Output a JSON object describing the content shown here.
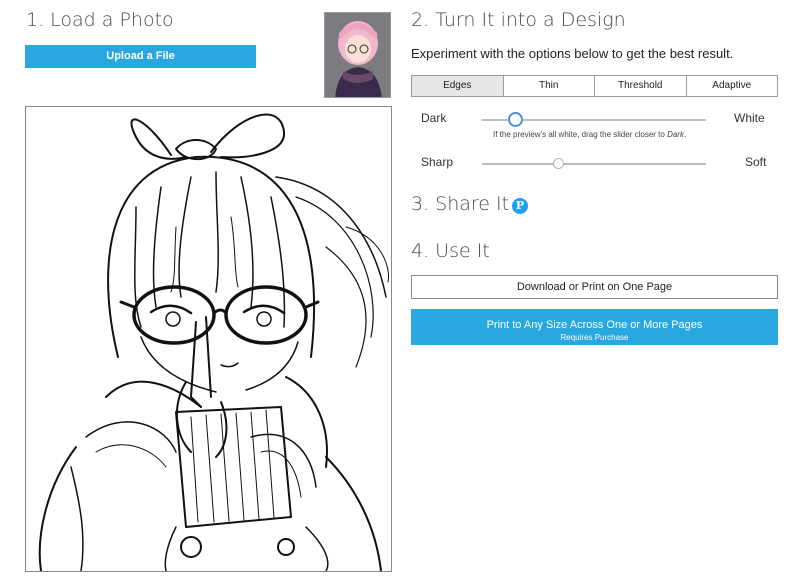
{
  "load_section": {
    "heading": "1. Load a Photo",
    "upload_label": "Upload a File"
  },
  "design_section": {
    "heading": "2. Turn It into a Design",
    "subtitle": "Experiment with the options below to get the best result.",
    "tabs": [
      {
        "label": "Edges",
        "active": true
      },
      {
        "label": "Thin",
        "active": false
      },
      {
        "label": "Threshold",
        "active": false
      },
      {
        "label": "Adaptive",
        "active": false
      }
    ],
    "slider_tone": {
      "left_label": "Dark",
      "right_label": "White",
      "value": 0.15,
      "hint_prefix": "If the preview's all white, drag the slider closer to ",
      "hint_emphasis": "Dark",
      "hint_suffix": "."
    },
    "slider_blur": {
      "left_label": "Sharp",
      "right_label": "Soft",
      "value": 0.34
    }
  },
  "share_section": {
    "heading": "3. Share It",
    "pinterest_icon": "pinterest-icon"
  },
  "use_section": {
    "heading": "4. Use It",
    "download_label": "Download or Print on One Page",
    "print_label": "Print to Any Size Across One or More Pages",
    "print_sublabel": "Requires Purchase"
  },
  "colors": {
    "accent": "#29a8e0",
    "pinterest": "#1da1f2",
    "slider_active": "#4a90d9"
  }
}
